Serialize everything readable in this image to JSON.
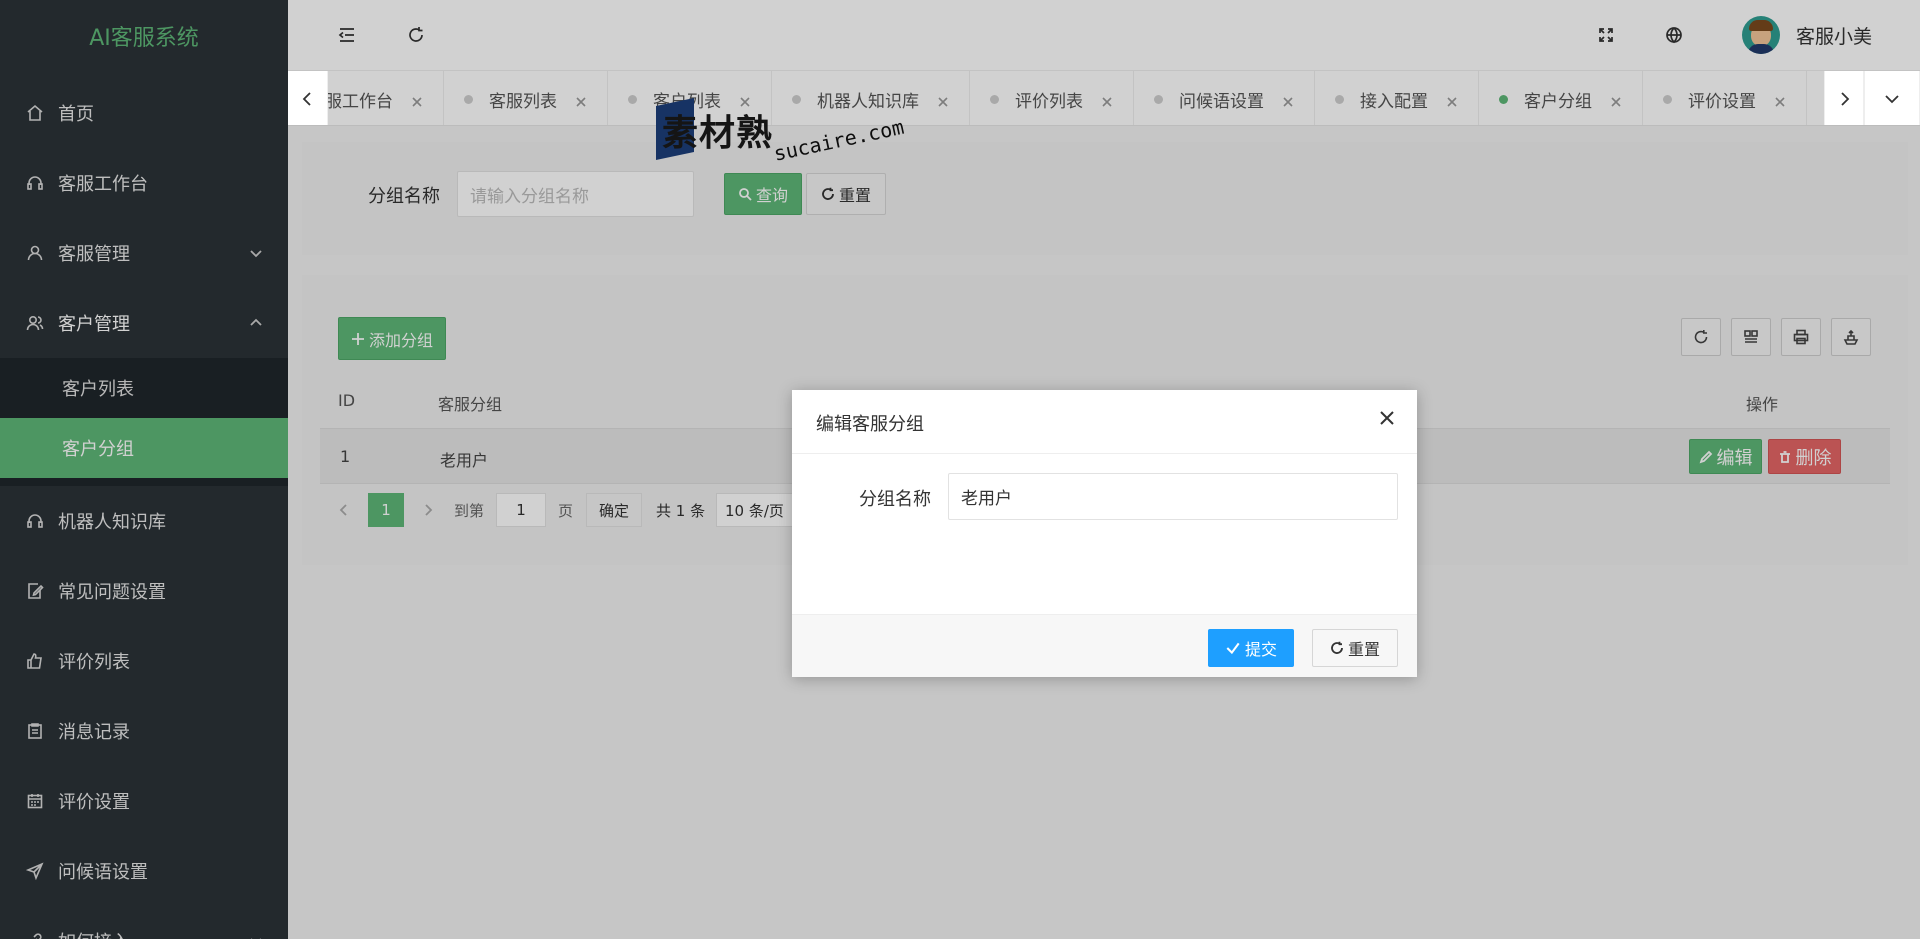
{
  "app": {
    "title": "AI客服系统"
  },
  "sidebar": {
    "items": [
      {
        "label": "首页",
        "icon": "home-icon"
      },
      {
        "label": "客服工作台",
        "icon": "headset-icon"
      },
      {
        "label": "客服管理",
        "icon": "user-icon",
        "expanded": false
      },
      {
        "label": "客户管理",
        "icon": "users-icon",
        "expanded": true
      },
      {
        "label": "机器人知识库",
        "icon": "robot-icon"
      },
      {
        "label": "常见问题设置",
        "icon": "edit-doc-icon"
      },
      {
        "label": "评价列表",
        "icon": "thumb-up-icon"
      },
      {
        "label": "消息记录",
        "icon": "clipboard-icon"
      },
      {
        "label": "评价设置",
        "icon": "calendar-icon"
      },
      {
        "label": "问候语设置",
        "icon": "send-icon"
      },
      {
        "label": "如何接入",
        "icon": "link-icon",
        "expanded": false
      }
    ],
    "submenu": [
      {
        "label": "客户列表",
        "active": false
      },
      {
        "label": "客户分组",
        "active": true
      }
    ]
  },
  "header": {
    "username": "客服小美"
  },
  "tabs": [
    {
      "label": "客服工作台",
      "active": false
    },
    {
      "label": "客服列表",
      "active": false
    },
    {
      "label": "客户列表",
      "active": false
    },
    {
      "label": "机器人知识库",
      "active": false
    },
    {
      "label": "评价列表",
      "active": false
    },
    {
      "label": "问候语设置",
      "active": false
    },
    {
      "label": "接入配置",
      "active": false
    },
    {
      "label": "客户分组",
      "active": true
    },
    {
      "label": "评价设置",
      "active": false
    }
  ],
  "search": {
    "label": "分组名称",
    "placeholder": "请输入分组名称",
    "query_label": "查询",
    "reset_label": "重置"
  },
  "table": {
    "add_label": "添加分组",
    "columns": [
      "ID",
      "客服分组",
      "操作"
    ],
    "rows": [
      {
        "id": "1",
        "group": "老用户",
        "edit_label": "编辑",
        "delete_label": "删除"
      }
    ]
  },
  "pagination": {
    "current_page": "1",
    "goto_label": "到第",
    "goto_value": "1",
    "page_unit": "页",
    "confirm_label": "确定",
    "total_text": "共 1 条",
    "page_size": "10 条/页"
  },
  "dialog": {
    "title": "编辑客服分组",
    "field_label": "分组名称",
    "field_value": "老用户",
    "submit_label": "提交",
    "reset_label": "重置"
  },
  "watermark": {
    "brand": "素材熟",
    "domain": "sucaire.com"
  },
  "colors": {
    "sidebar_bg": "#2b3338",
    "accent_green": "#5fb878",
    "primary_blue": "#1e9fff",
    "danger_red": "#e56666"
  }
}
